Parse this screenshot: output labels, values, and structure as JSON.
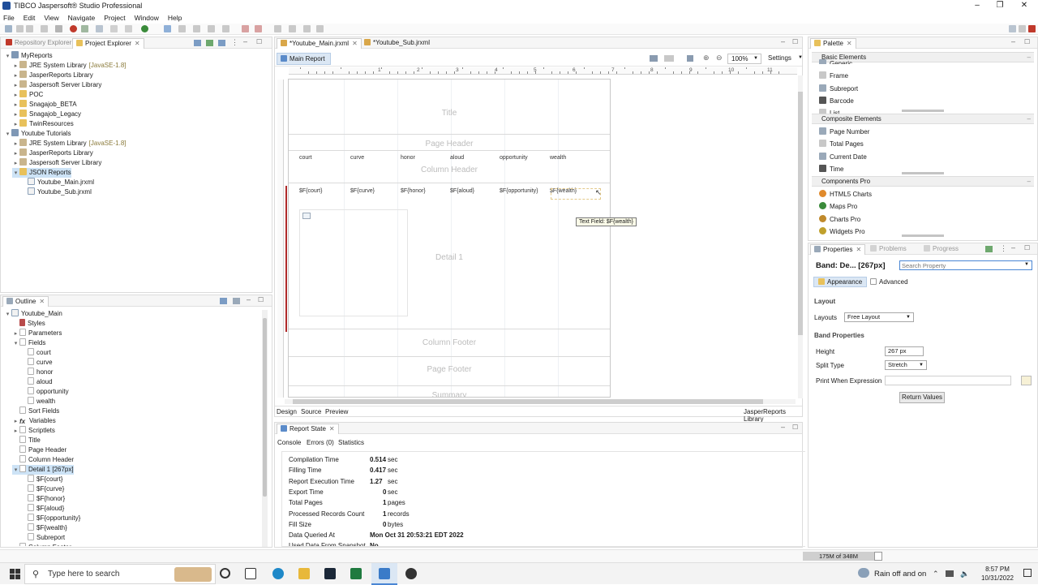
{
  "window": {
    "title": "TIBCO Jaspersoft® Studio Professional"
  },
  "menu": [
    "File",
    "Edit",
    "View",
    "Navigate",
    "Project",
    "Window",
    "Help"
  ],
  "left_tabs": {
    "repository": "Repository Explorer",
    "project": "Project Explorer"
  },
  "project_tree": [
    {
      "label": "MyReports",
      "level": 0,
      "kind": "proj",
      "arrow": "▾"
    },
    {
      "label": "JRE System Library",
      "suffix": "[JavaSE-1.8]",
      "level": 1,
      "kind": "lib",
      "arrow": "▸"
    },
    {
      "label": "JasperReports Library",
      "level": 1,
      "kind": "lib",
      "arrow": "▸"
    },
    {
      "label": "Jaspersoft Server Library",
      "level": 1,
      "kind": "lib",
      "arrow": "▸"
    },
    {
      "label": "POC",
      "level": 1,
      "kind": "folder",
      "arrow": "▸"
    },
    {
      "label": "Snagajob_BETA",
      "level": 1,
      "kind": "folder",
      "arrow": "▸"
    },
    {
      "label": "Snagajob_Legacy",
      "level": 1,
      "kind": "folder",
      "arrow": "▸"
    },
    {
      "label": "TwinResources",
      "level": 1,
      "kind": "folder",
      "arrow": "▸"
    },
    {
      "label": "Youtube Tutorials",
      "level": 0,
      "kind": "proj",
      "arrow": "▾"
    },
    {
      "label": "JRE System Library",
      "suffix": "[JavaSE-1.8]",
      "level": 1,
      "kind": "lib",
      "arrow": "▸"
    },
    {
      "label": "JasperReports Library",
      "level": 1,
      "kind": "lib",
      "arrow": "▸"
    },
    {
      "label": "Jaspersoft Server Library",
      "level": 1,
      "kind": "lib",
      "arrow": "▸"
    },
    {
      "label": "JSON Reports",
      "level": 1,
      "kind": "folder",
      "arrow": "▾",
      "selected": true
    },
    {
      "label": "Youtube_Main.jrxml",
      "level": 2,
      "kind": "file",
      "arrow": ""
    },
    {
      "label": "Youtube_Sub.jrxml",
      "level": 2,
      "kind": "file",
      "arrow": ""
    }
  ],
  "outline": {
    "tab": "Outline",
    "items": [
      {
        "label": "Youtube_Main",
        "level": 0,
        "kind": "file",
        "arrow": "▾"
      },
      {
        "label": "Styles",
        "level": 1,
        "kind": "style",
        "arrow": ""
      },
      {
        "label": "Parameters",
        "level": 1,
        "kind": "field",
        "arrow": "▸"
      },
      {
        "label": "Fields",
        "level": 1,
        "kind": "field",
        "arrow": "▾"
      },
      {
        "label": "court",
        "level": 2,
        "kind": "field",
        "arrow": ""
      },
      {
        "label": "curve",
        "level": 2,
        "kind": "field",
        "arrow": ""
      },
      {
        "label": "honor",
        "level": 2,
        "kind": "field",
        "arrow": ""
      },
      {
        "label": "aloud",
        "level": 2,
        "kind": "field",
        "arrow": ""
      },
      {
        "label": "opportunity",
        "level": 2,
        "kind": "field",
        "arrow": ""
      },
      {
        "label": "wealth",
        "level": 2,
        "kind": "field",
        "arrow": ""
      },
      {
        "label": "Sort Fields",
        "level": 1,
        "kind": "field",
        "arrow": ""
      },
      {
        "label": "Variables",
        "level": 1,
        "kind": "fx",
        "arrow": "▸"
      },
      {
        "label": "Scriptlets",
        "level": 1,
        "kind": "field",
        "arrow": "▸"
      },
      {
        "label": "Title",
        "level": 1,
        "kind": "field",
        "arrow": ""
      },
      {
        "label": "Page Header",
        "level": 1,
        "kind": "field",
        "arrow": ""
      },
      {
        "label": "Column Header",
        "level": 1,
        "kind": "field",
        "arrow": ""
      },
      {
        "label": "Detail 1 [267px]",
        "level": 1,
        "kind": "field",
        "arrow": "▾",
        "selected": true
      },
      {
        "label": "$F{court}",
        "level": 2,
        "kind": "field",
        "arrow": ""
      },
      {
        "label": "$F{curve}",
        "level": 2,
        "kind": "field",
        "arrow": ""
      },
      {
        "label": "$F{honor}",
        "level": 2,
        "kind": "field",
        "arrow": ""
      },
      {
        "label": "$F{aloud}",
        "level": 2,
        "kind": "field",
        "arrow": ""
      },
      {
        "label": "$F{opportunity}",
        "level": 2,
        "kind": "field",
        "arrow": ""
      },
      {
        "label": "$F{wealth}",
        "level": 2,
        "kind": "field",
        "arrow": ""
      },
      {
        "label": "Subreport",
        "level": 2,
        "kind": "field",
        "arrow": ""
      },
      {
        "label": "Column Footer",
        "level": 1,
        "kind": "field",
        "arrow": ""
      }
    ]
  },
  "editor": {
    "tabs": [
      "*Youtube_Main.jrxml",
      "*Youtube_Sub.jrxml"
    ],
    "subtab": "Main Report",
    "zoom": "100%",
    "settings": "Settings",
    "bottom_tabs": [
      "Design",
      "Source",
      "Preview"
    ],
    "library_label": "JasperReports Library",
    "ruler_numbers": [
      "1",
      "2",
      "3",
      "4",
      "5",
      "6",
      "7",
      "8",
      "9",
      "10",
      "11",
      "12"
    ],
    "bands": {
      "title": "Title",
      "page_header": "Page Header",
      "column_header": "Column Header",
      "detail": "Detail 1",
      "column_footer": "Column Footer",
      "page_footer": "Page Footer",
      "summary": "Summary"
    },
    "column_headers": [
      "court",
      "curve",
      "honor",
      "aloud",
      "opportunity",
      "wealth"
    ],
    "detail_fields": [
      "$F{court}",
      "$F{curve}",
      "$F{honor}",
      "$F{aloud}",
      "$F{opportunity}",
      "$F{wealth}"
    ],
    "tooltip": "Text Field: $F{wealth}"
  },
  "report_state": {
    "tab": "Report State",
    "subtabs": [
      "Console",
      "Errors (0)",
      "Statistics"
    ],
    "rows": [
      {
        "label": "Compilation Time",
        "value": "0.514",
        "unit": "sec"
      },
      {
        "label": "Filling Time",
        "value": "0.417",
        "unit": "sec"
      },
      {
        "label": "Report Execution Time",
        "value": "1.27",
        "unit": "sec"
      },
      {
        "label": "Export Time",
        "value": "0",
        "unit": "sec"
      },
      {
        "label": "Total Pages",
        "value": "1",
        "unit": "pages"
      },
      {
        "label": "Processed Records Count",
        "value": "1",
        "unit": "records"
      },
      {
        "label": "Fill Size",
        "value": "0",
        "unit": "bytes"
      },
      {
        "label": "Data Queried At",
        "value": "Mon Oct 31 20:53:21 EDT 2022",
        "unit": ""
      },
      {
        "label": "Used Data From Snapshot",
        "value": "No",
        "unit": ""
      }
    ]
  },
  "palette": {
    "tab": "Palette",
    "sections": [
      {
        "title": "Basic Elements",
        "items": [
          "Generic",
          "Frame",
          "Subreport",
          "Barcode",
          "List"
        ]
      },
      {
        "title": "Composite Elements",
        "items": [
          "Page Number",
          "Total Pages",
          "Current Date",
          "Time"
        ]
      },
      {
        "title": "Components Pro",
        "items": [
          "HTML5 Charts",
          "Maps Pro",
          "Charts Pro",
          "Widgets Pro"
        ]
      }
    ]
  },
  "properties": {
    "tabs": [
      "Properties",
      "Problems",
      "Progress"
    ],
    "heading": "Band: De... [267px]",
    "search_placeholder": "Search Property",
    "subtabs": [
      "Appearance",
      "Advanced"
    ],
    "layout_section": "Layout",
    "layouts_label": "Layouts",
    "layouts_value": "Free Layout",
    "band_section": "Band Properties",
    "height_label": "Height",
    "height_value": "267 px",
    "split_label": "Split Type",
    "split_value": "Stretch",
    "print_label": "Print When Expression",
    "return_values": "Return Values"
  },
  "status": {
    "memory": "175M of 348M"
  },
  "taskbar": {
    "search_placeholder": "Type here to search",
    "weather": "Rain off and on",
    "time": "8:57 PM",
    "date": "10/31/2022"
  }
}
